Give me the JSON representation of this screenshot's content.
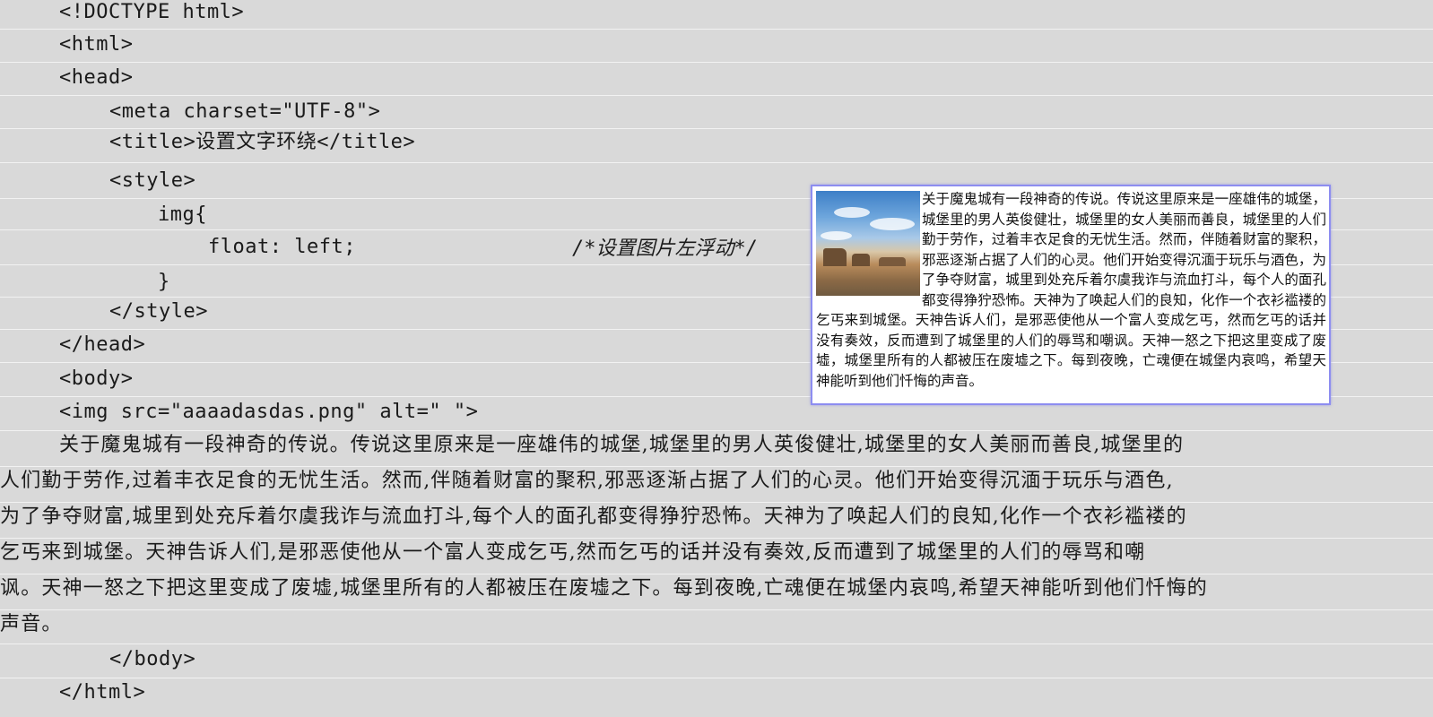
{
  "code": {
    "doctype": "<!DOCTYPE html>",
    "html_open": "<html>",
    "head_open": "<head>",
    "meta": "<meta charset=\"UTF-8\">",
    "title": "<title>设置文字环绕</title>",
    "style_open": "<style>",
    "img_selector": "img{",
    "float_rule": "float: left;",
    "float_comment": "/*设置图片左浮动*/",
    "brace_close": "}",
    "style_close": "</style>",
    "head_close": "</head>",
    "body_open": "<body>",
    "img_tag": "<img src=\"aaaadasdas.png\" alt=\" \">",
    "body_close": "</body>",
    "html_close": "</html>"
  },
  "paragraph_lines": [
    "关于魔鬼城有一段神奇的传说。传说这里原来是一座雄伟的城堡,城堡里的男人英俊健壮,城堡里的女人美丽而善良,城堡里的",
    "人们勤于劳作,过着丰衣足食的无忧生活。然而,伴随着财富的聚积,邪恶逐渐占据了人们的心灵。他们开始变得沉湎于玩乐与酒色,",
    "为了争夺财富,城里到处充斥着尔虞我诈与流血打斗,每个人的面孔都变得狰狞恐怖。天神为了唤起人们的良知,化作一个衣衫褴褛的",
    "乞丐来到城堡。天神告诉人们,是邪恶使他从一个富人变成乞丐,然而乞丐的话并没有奏效,反而遭到了城堡里的人们的辱骂和嘲",
    "讽。天神一怒之下把这里变成了废墟,城堡里所有的人都被压在废墟之下。每到夜晚,亡魂便在城堡内哀鸣,希望天神能听到他们忏悔的",
    "声音。"
  ],
  "preview": {
    "text": "关于魔鬼城有一段神奇的传说。传说这里原来是一座雄伟的城堡，城堡里的男人英俊健壮，城堡里的女人美丽而善良，城堡里的人们勤于劳作，过着丰衣足食的无忧生活。然而，伴随着财富的聚积，邪恶逐渐占据了人们的心灵。他们开始变得沉湎于玩乐与酒色，为了争夺财富，城里到处充斥着尔虞我诈与流血打斗，每个人的面孔都变得狰狞恐怖。天神为了唤起人们的良知，化作一个衣衫褴褛的乞丐来到城堡。天神告诉人们，是邪恶使他从一个富人变成乞丐，然而乞丐的话并没有奏效，反而遭到了城堡里的人们的辱骂和嘲讽。天神一怒之下把这里变成了废墟，城堡里所有的人都被压在废墟之下。每到夜晚，亡魂便在城堡内哀鸣，希望天神能听到他们忏悔的声音。",
    "border_color": "#8d8df0"
  }
}
